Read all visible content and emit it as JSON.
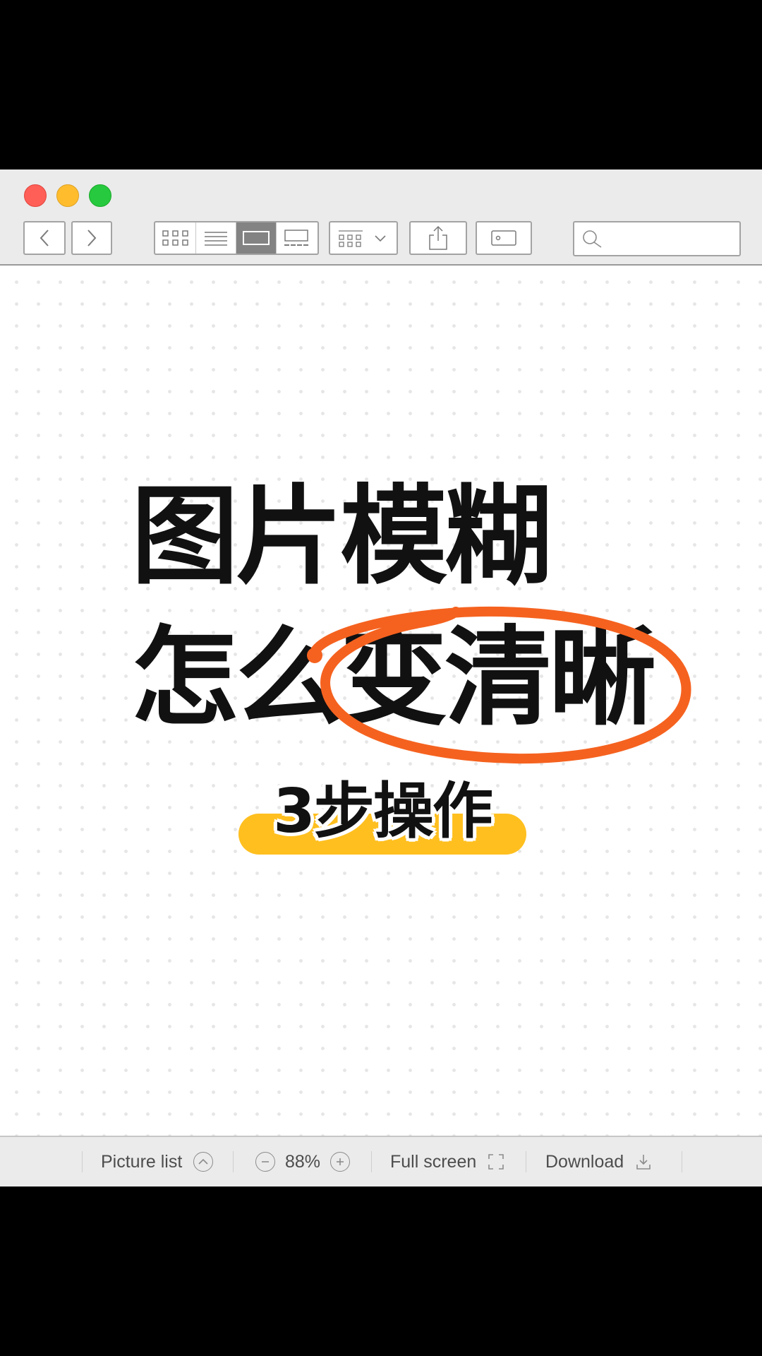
{
  "toolbar": {
    "search": {
      "placeholder": "",
      "value": ""
    }
  },
  "content": {
    "headline_line1": "图片模糊",
    "headline_line2_prefix": "怎么",
    "headline_line2_circled": "变清晰",
    "subtitle": "3步操作",
    "circle_color": "#f5621f",
    "pill_color": "#ffbf1f"
  },
  "statusbar": {
    "picture_list_label": "Picture list",
    "zoom_value": "88%",
    "fullscreen_label": "Full screen",
    "download_label": "Download"
  },
  "icons": {
    "traffic_lights": [
      "close",
      "minimize",
      "zoom"
    ],
    "toolbar": [
      "chevron-left-icon",
      "chevron-right-icon",
      "grid-view-icon",
      "list-view-icon",
      "single-view-icon",
      "filmstrip-view-icon",
      "arrange-icon",
      "share-icon",
      "tag-icon",
      "search-icon"
    ],
    "statusbar": [
      "chevron-up-icon",
      "zoom-out-icon",
      "zoom-in-icon",
      "fullscreen-icon",
      "download-icon"
    ]
  }
}
